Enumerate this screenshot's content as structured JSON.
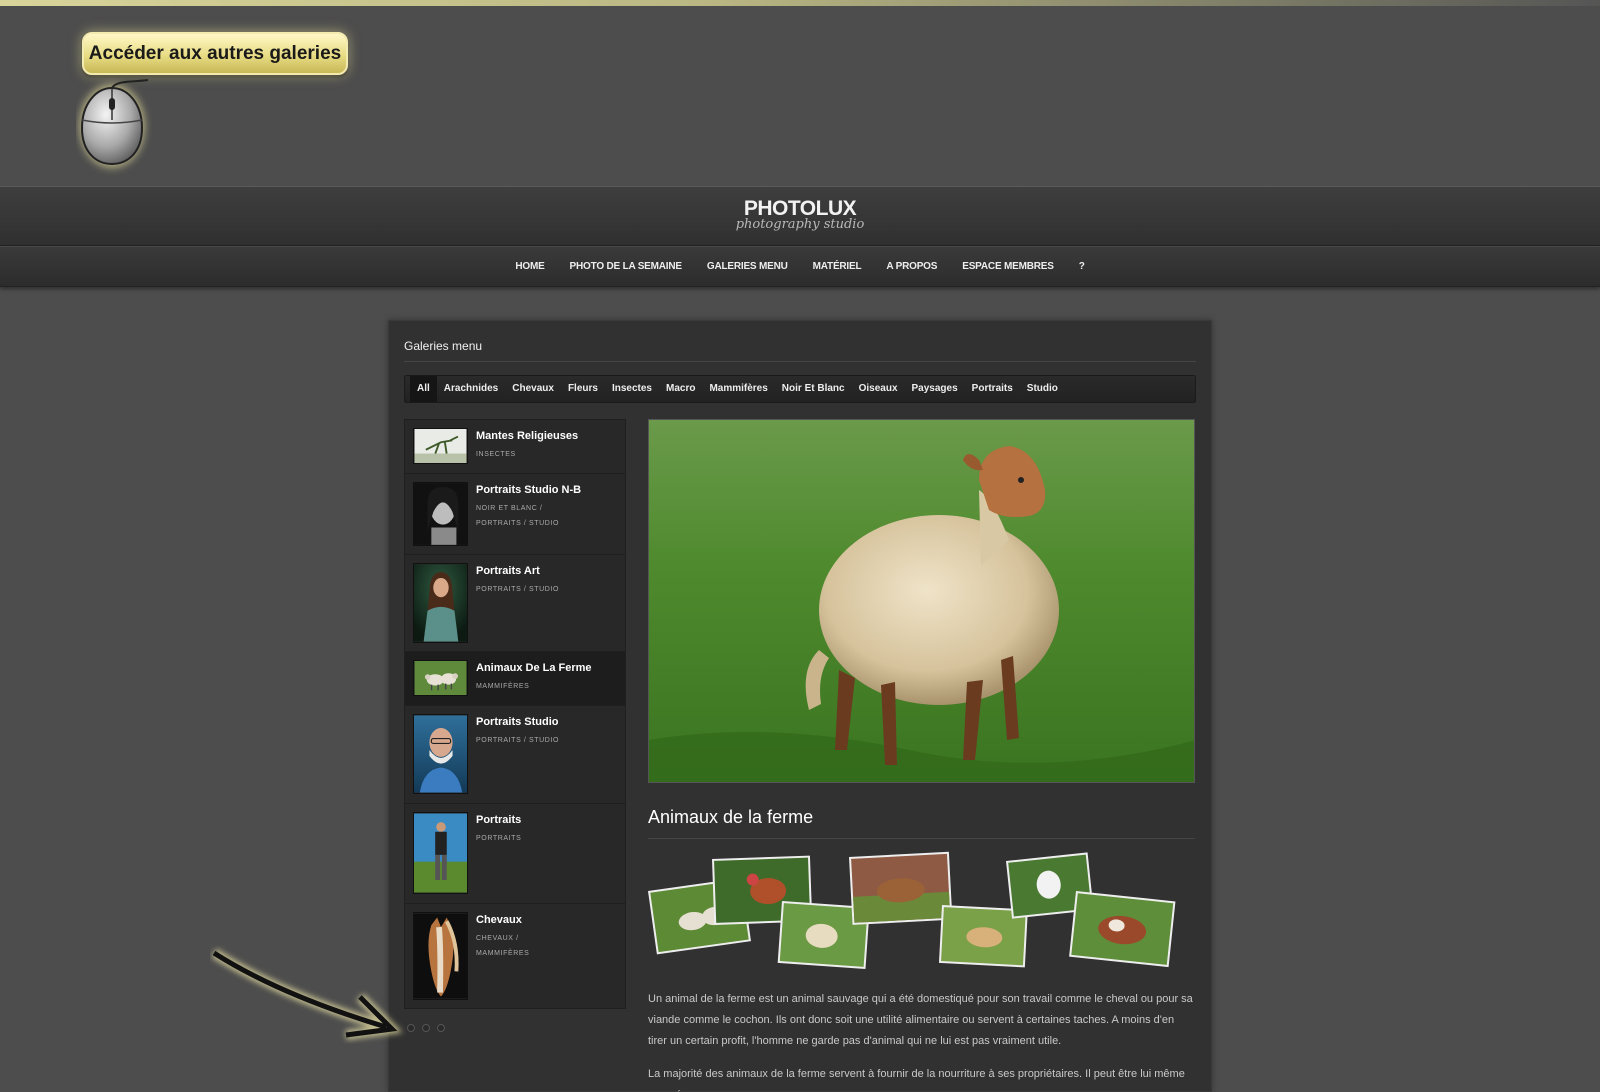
{
  "callout": {
    "text": "Accéder aux autres galeries"
  },
  "site": {
    "logo": "PHOTOLUX",
    "tagline": "photography studio"
  },
  "nav": {
    "items": [
      "HOME",
      "PHOTO DE LA SEMAINE",
      "GALERIES MENU",
      "MATÉRIEL",
      "A PROPOS",
      "ESPACE MEMBRES",
      "?"
    ]
  },
  "panel": {
    "title": "Galeries menu"
  },
  "filters": [
    "All",
    "Arachnides",
    "Chevaux",
    "Fleurs",
    "Insectes",
    "Macro",
    "Mammifères",
    "Noir Et Blanc",
    "Oiseaux",
    "Paysages",
    "Portraits",
    "Studio"
  ],
  "active_filter": "All",
  "galleries": [
    {
      "title": "Mantes Religieuses",
      "category": "INSECTES"
    },
    {
      "title": "Portraits Studio N-B",
      "category": "NOIR ET BLANC / PORTRAITS / STUDIO"
    },
    {
      "title": "Portraits Art",
      "category": "PORTRAITS / STUDIO"
    },
    {
      "title": "Animaux De La Ferme",
      "category": "MAMMIFÈRES"
    },
    {
      "title": "Portraits Studio",
      "category": "PORTRAITS / STUDIO"
    },
    {
      "title": "Portraits",
      "category": "PORTRAITS"
    },
    {
      "title": "Chevaux",
      "category": "CHEVAUX / MAMMIFÈRES"
    }
  ],
  "selected_gallery": "Animaux De La Ferme",
  "detail": {
    "title": "Animaux de la ferme",
    "paragraphs": [
      "Un animal de la ferme est un animal sauvage qui a été domestiqué pour son travail comme le cheval ou pour sa viande comme le cochon. Ils ont donc soit une utilité alimentaire ou servent à certaines taches. A moins d'en tirer un certain profit, l'homme ne garde pas d'animal qui ne lui est pas vraiment utile.",
      "La majorité des animaux de la ferme servent à fournir de la nourriture à ses propriétaires. Il peut être lui même mangé, ou"
    ]
  },
  "pagination": {
    "pages": 3
  },
  "colors": {
    "accent": "#e8dc84",
    "background": "#4d4d4d",
    "panel": "#313131"
  }
}
